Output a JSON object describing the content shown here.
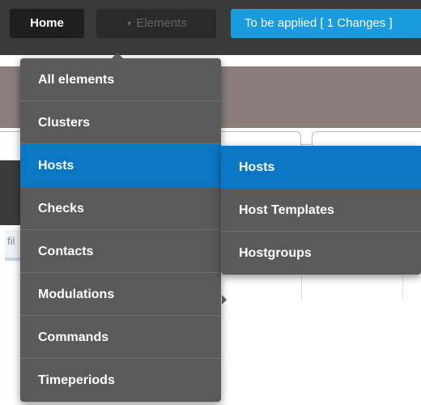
{
  "topbar": {
    "home_label": "Home",
    "elements_label": "Elements",
    "apply_label": "To be applied [ 1 Changes ]"
  },
  "background": {
    "filter_text": "fil"
  },
  "elements_menu": {
    "items": [
      {
        "label": "All elements"
      },
      {
        "label": "Clusters"
      },
      {
        "label": "Hosts",
        "active": true
      },
      {
        "label": "Checks"
      },
      {
        "label": "Contacts"
      },
      {
        "label": "Modulations"
      },
      {
        "label": "Commands"
      },
      {
        "label": "Timeperiods"
      }
    ]
  },
  "hosts_submenu": {
    "items": [
      {
        "label": "Hosts",
        "active": true
      },
      {
        "label": "Host Templates"
      },
      {
        "label": "Hostgroups"
      }
    ]
  },
  "colors": {
    "menu_bg": "#5a5a5a",
    "active_bg": "#0b76c4",
    "apply_bg": "#1a9bde"
  },
  "icons": {
    "elements_caret": "caret-down-icon"
  }
}
